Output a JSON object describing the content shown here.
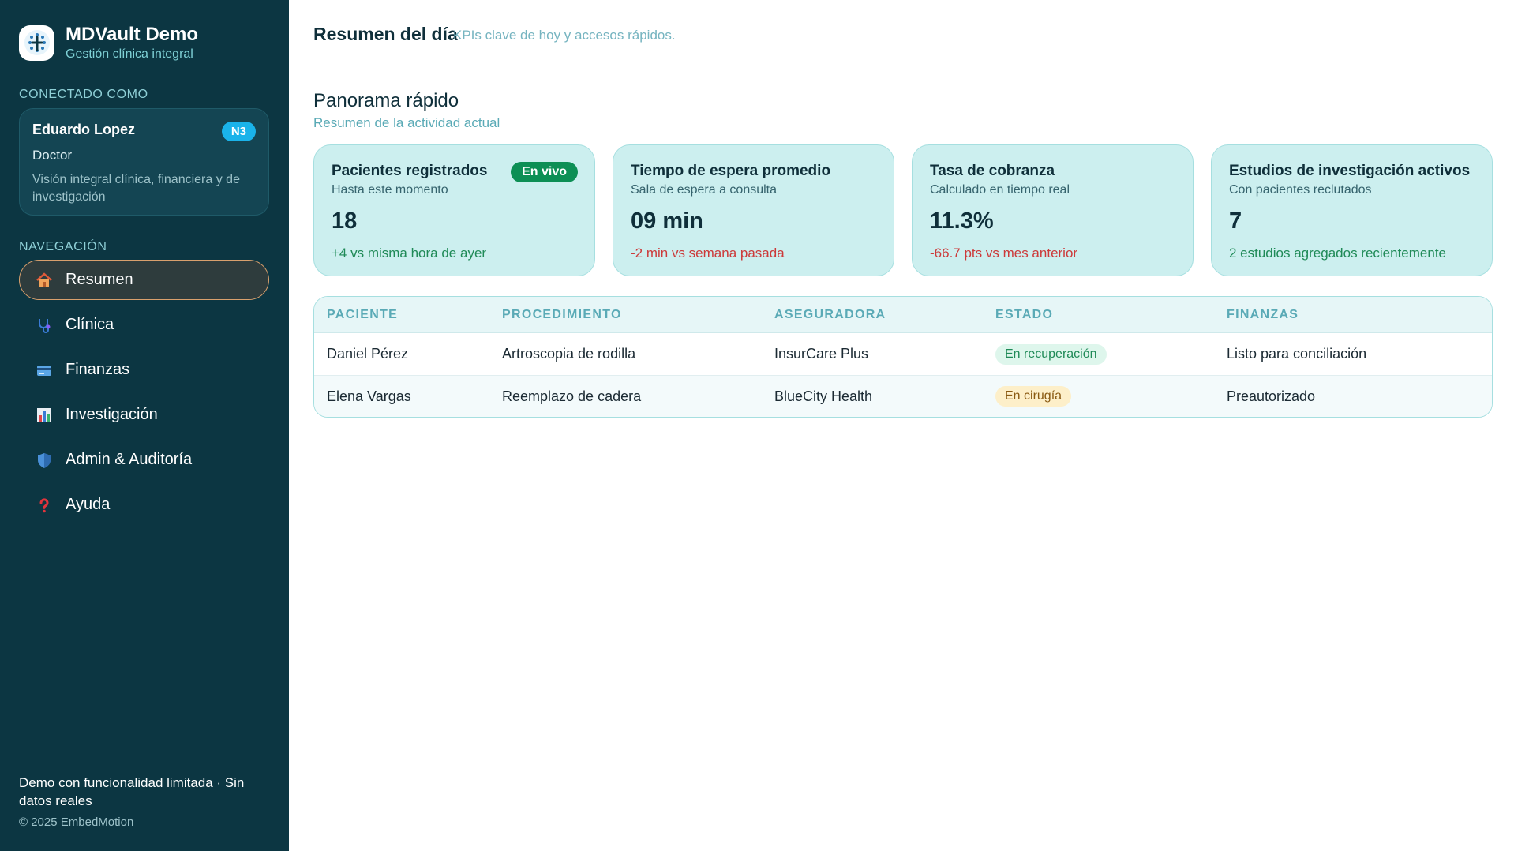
{
  "app": {
    "title": "MDVault Demo",
    "subtitle": "Gestión clínica integral"
  },
  "user_section": {
    "label": "CONECTADO COMO",
    "name": "Eduardo Lopez",
    "badge": "N3",
    "role": "Doctor",
    "description": "Visión integral clínica, financiera y de investigación"
  },
  "nav": {
    "label": "NAVEGACIÓN",
    "items": [
      {
        "label": "Resumen",
        "icon": "home-icon",
        "active": true
      },
      {
        "label": "Clínica",
        "icon": "stethoscope-icon",
        "active": false
      },
      {
        "label": "Finanzas",
        "icon": "credit-card-icon",
        "active": false
      },
      {
        "label": "Investigación",
        "icon": "bar-chart-icon",
        "active": false
      },
      {
        "label": "Admin & Auditoría",
        "icon": "shield-icon",
        "active": false
      },
      {
        "label": "Ayuda",
        "icon": "question-icon",
        "active": false
      }
    ]
  },
  "footer": {
    "note": "Demo con funcionalidad limitada · Sin datos reales",
    "copyright": "© 2025 EmbedMotion"
  },
  "header": {
    "title": "Resumen del día",
    "subtitle": "KPIs clave de hoy y accesos rápidos."
  },
  "section": {
    "title": "Panorama rápido",
    "subtitle": "Resumen de la actividad actual"
  },
  "kpis": [
    {
      "title": "Pacientes registrados",
      "sub": "Hasta este momento",
      "value": "18",
      "delta": "+4 vs misma hora de ayer",
      "trend": "pos",
      "badge": "En vivo"
    },
    {
      "title": "Tiempo de espera promedio",
      "sub": "Sala de espera a consulta",
      "value": "09 min",
      "delta": "-2 min vs semana pasada",
      "trend": "neg"
    },
    {
      "title": "Tasa de cobranza",
      "sub": "Calculado en tiempo real",
      "value": "11.3%",
      "delta": "-66.7 pts vs mes anterior",
      "trend": "neg"
    },
    {
      "title": "Estudios de investigación activos",
      "sub": "Con pacientes reclutados",
      "value": "7",
      "delta": "2 estudios agregados recientemente",
      "trend": "pos"
    }
  ],
  "table": {
    "headers": [
      "PACIENTE",
      "PROCEDIMIENTO",
      "ASEGURADORA",
      "ESTADO",
      "FINANZAS"
    ],
    "rows": [
      {
        "paciente": "Daniel Pérez",
        "procedimiento": "Artroscopia de rodilla",
        "aseguradora": "InsurCare Plus",
        "estado": "En recuperación",
        "finanzas": "Listo para conciliación"
      },
      {
        "paciente": "Elena Vargas",
        "procedimiento": "Reemplazo de cadera",
        "aseguradora": "BlueCity Health",
        "estado": "En cirugía",
        "finanzas": "Preautorizado"
      }
    ]
  },
  "colors": {
    "sidebar": "#0c3642",
    "card": "#ccefef",
    "accent": "#1ab3ea",
    "live": "#0d8f55",
    "positive": "#1f8a57",
    "negative": "#cc3a3a"
  }
}
